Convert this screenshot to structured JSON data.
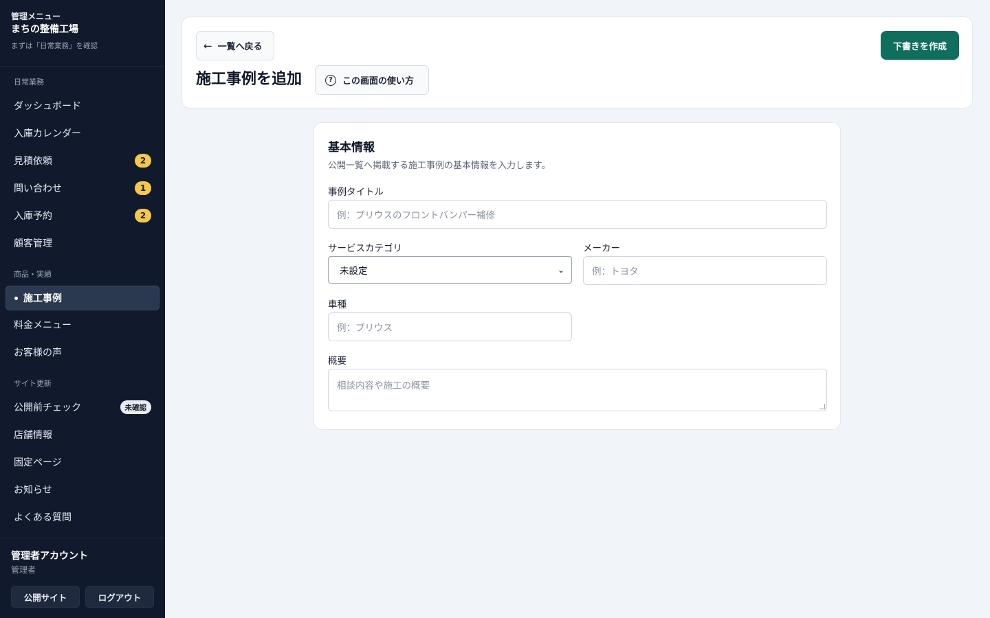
{
  "sidebar": {
    "eyebrow": "管理メニュー",
    "app_name": "まちの整備工場",
    "hint": "まずは「日常業務」を確認",
    "sections": [
      {
        "label": "日常業務"
      },
      {
        "label": "商品・実績"
      },
      {
        "label": "サイト更新"
      }
    ],
    "items": [
      {
        "label": "ダッシュボード"
      },
      {
        "label": "入庫カレンダー"
      },
      {
        "label": "見積依頼",
        "badge": "2"
      },
      {
        "label": "問い合わせ",
        "badge": "1"
      },
      {
        "label": "入庫予約",
        "badge": "2"
      },
      {
        "label": "顧客管理"
      },
      {
        "label": "施工事例",
        "active": true
      },
      {
        "label": "料金メニュー"
      },
      {
        "label": "お客様の声"
      },
      {
        "label": "公開前チェック",
        "badge": "未確認"
      },
      {
        "label": "店舗情報"
      },
      {
        "label": "固定ページ"
      },
      {
        "label": "お知らせ"
      },
      {
        "label": "よくある質問"
      }
    ],
    "footer": {
      "user": "管理者アカウント",
      "role": "管理者",
      "public_site": "公開サイト",
      "logout": "ログアウト"
    }
  },
  "header": {
    "back_label": "一覧へ戻る",
    "title": "施工事例を追加",
    "help_label": "この画面の使い方",
    "primary_label": "下書きを作成"
  },
  "form": {
    "section_title": "基本情報",
    "section_desc": "公開一覧へ掲載する施工事例の基本情報を入力します。",
    "title_label": "事例タイトル",
    "title_placeholder": "例：プリウスのフロントバンパー補修",
    "category_label": "サービスカテゴリ",
    "category_value": "未設定",
    "maker_label": "メーカー",
    "maker_placeholder": "例：トヨタ",
    "model_label": "車種",
    "model_placeholder": "例：プリウス",
    "summary_label": "概要",
    "summary_placeholder": "相談内容や施工の概要"
  },
  "colors": {
    "sidebar_bg": "#111a2c",
    "accent": "#0f6e5e",
    "badge": "#f5c84b",
    "page_bg": "#f1f4f8"
  },
  "icons": {
    "back": "arrow-left-icon",
    "help": "question-circle-icon",
    "select": "chevron-down-icon"
  }
}
